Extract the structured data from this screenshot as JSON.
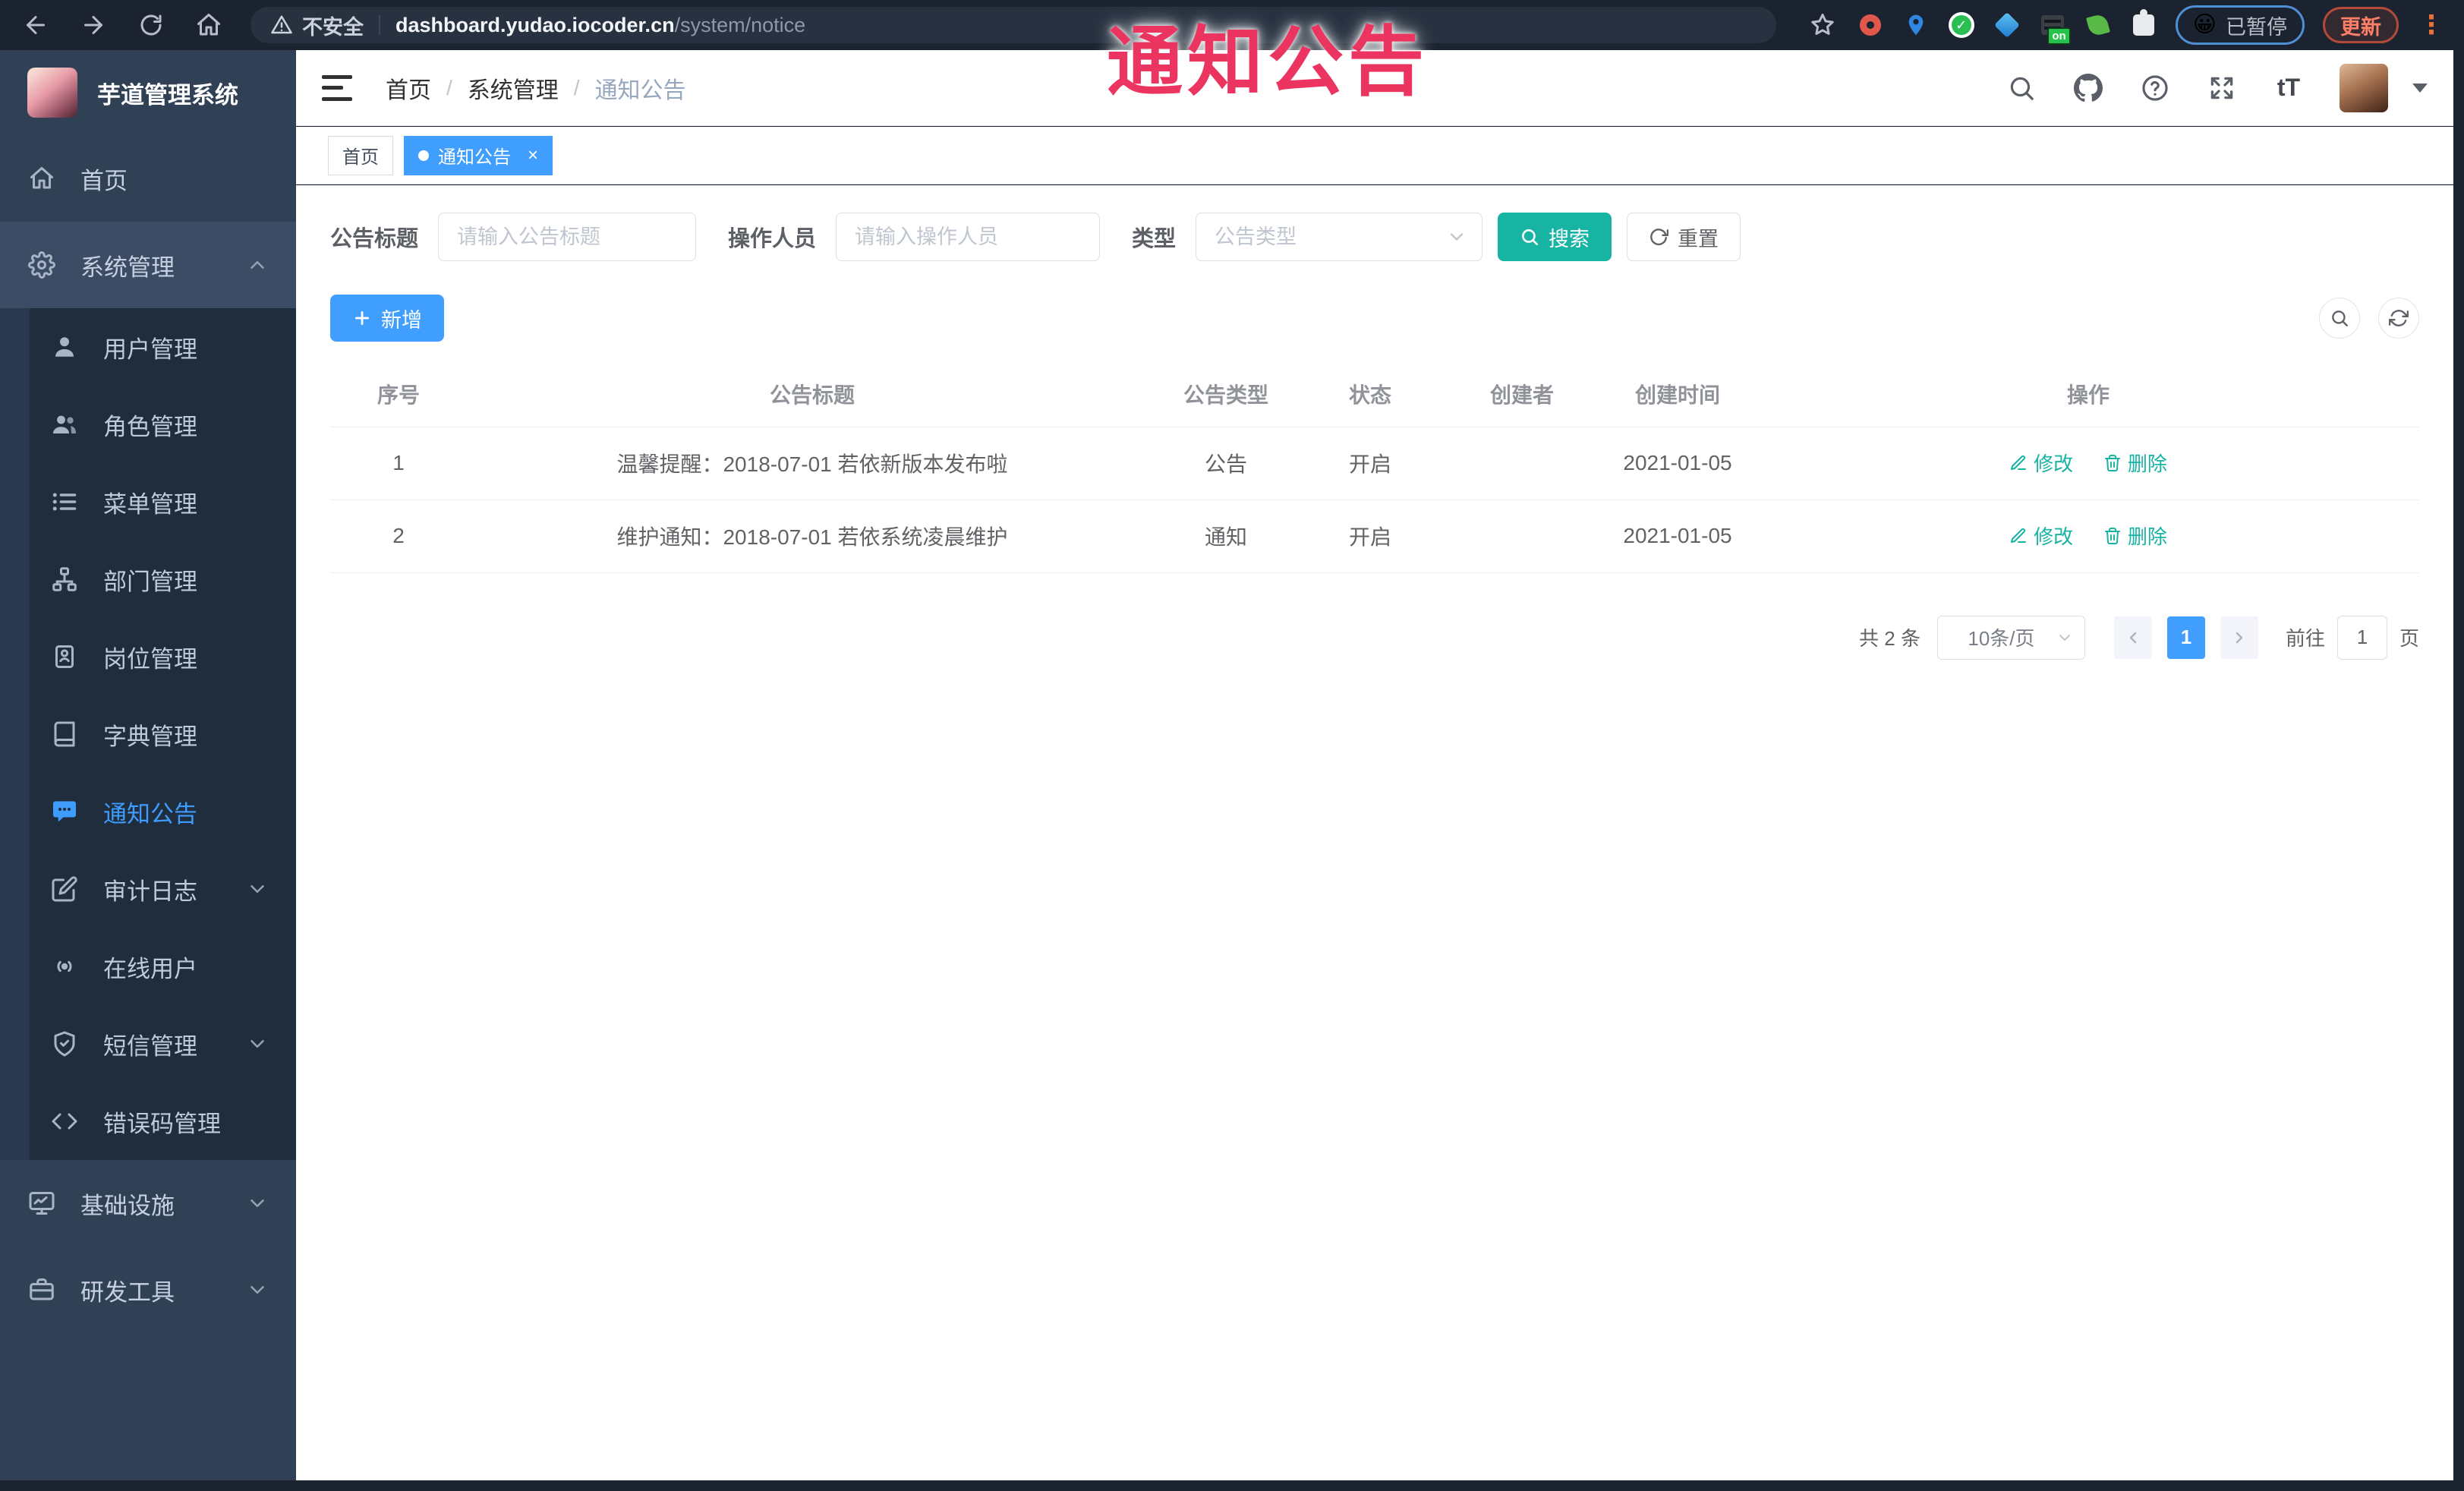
{
  "overlay": {
    "title": "通知公告"
  },
  "browser": {
    "security_label": "不安全",
    "url_host": "dashboard.yudao.iocoder.cn",
    "url_path": "/system/notice",
    "paused_label": "已暂停",
    "update_label": "更新",
    "on_badge": "on"
  },
  "sidebar": {
    "title": "芋道管理系统",
    "items": [
      {
        "label": "首页",
        "icon": "home-icon",
        "level": 1
      },
      {
        "label": "系统管理",
        "icon": "gear-icon",
        "level": 1,
        "open": true
      },
      {
        "label": "用户管理",
        "icon": "user-icon",
        "level": 2
      },
      {
        "label": "角色管理",
        "icon": "users-icon",
        "level": 2
      },
      {
        "label": "菜单管理",
        "icon": "menu-list-icon",
        "level": 2
      },
      {
        "label": "部门管理",
        "icon": "org-tree-icon",
        "level": 2
      },
      {
        "label": "岗位管理",
        "icon": "badge-icon",
        "level": 2
      },
      {
        "label": "字典管理",
        "icon": "book-icon",
        "level": 2
      },
      {
        "label": "通知公告",
        "icon": "message-icon",
        "level": 2,
        "active": true
      },
      {
        "label": "审计日志",
        "icon": "log-icon",
        "level": 2,
        "arrow": "down"
      },
      {
        "label": "在线用户",
        "icon": "online-icon",
        "level": 2
      },
      {
        "label": "短信管理",
        "icon": "shield-icon",
        "level": 2,
        "arrow": "down"
      },
      {
        "label": "错误码管理",
        "icon": "code-icon",
        "level": 2
      },
      {
        "label": "基础设施",
        "icon": "monitor-icon",
        "level": 1,
        "arrow": "down"
      },
      {
        "label": "研发工具",
        "icon": "toolbox-icon",
        "level": 1,
        "arrow": "down"
      }
    ]
  },
  "header": {
    "breadcrumb": [
      "首页",
      "系统管理",
      "通知公告"
    ]
  },
  "tags": {
    "items": [
      {
        "label": "首页",
        "active": false
      },
      {
        "label": "通知公告",
        "active": true,
        "closable": true
      }
    ]
  },
  "filters": {
    "title_label": "公告标题",
    "title_placeholder": "请输入公告标题",
    "operator_label": "操作人员",
    "operator_placeholder": "请输入操作人员",
    "type_label": "类型",
    "type_placeholder": "公告类型",
    "search_label": "搜索",
    "reset_label": "重置"
  },
  "toolbar": {
    "add_label": "新增"
  },
  "table": {
    "columns": [
      "序号",
      "公告标题",
      "公告类型",
      "状态",
      "创建者",
      "创建时间",
      "操作"
    ],
    "rows": [
      {
        "no": "1",
        "title": "温馨提醒：2018-07-01 若依新版本发布啦",
        "type": "公告",
        "status": "开启",
        "creator": "",
        "created": "2021-01-05"
      },
      {
        "no": "2",
        "title": "维护通知：2018-07-01 若依系统凌晨维护",
        "type": "通知",
        "status": "开启",
        "creator": "",
        "created": "2021-01-05"
      }
    ],
    "ops": {
      "edit": "修改",
      "del": "删除"
    }
  },
  "pagination": {
    "total": "共 2 条",
    "page_size": "10条/页",
    "current": "1",
    "goto_label": "前往",
    "goto_value": "1",
    "unit": "页"
  },
  "colors": {
    "accent": "#409eff",
    "theme_teal": "#17b3a3",
    "sidebar_bg": "#304156",
    "submenu_bg": "#1f2d3d",
    "annotation": "#eb3560"
  }
}
